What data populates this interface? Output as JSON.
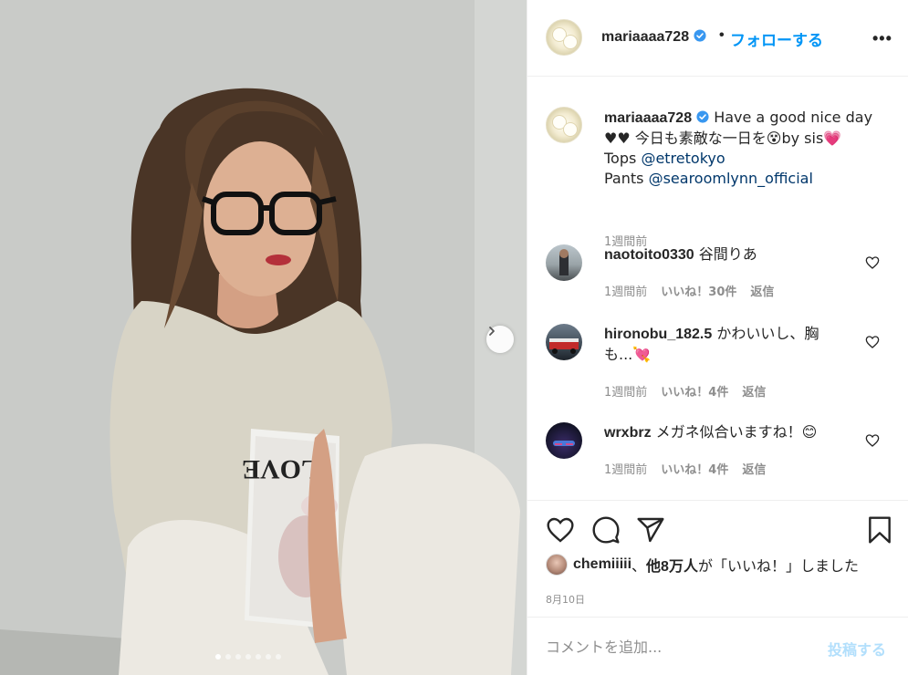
{
  "post": {
    "image_alt": "",
    "carousel_total": 7,
    "carousel_active": 1
  },
  "header": {
    "username": "mariaaaa728",
    "separator": "•",
    "follow_label": "フォローする",
    "more_label": "•••"
  },
  "caption": {
    "username": "mariaaaa728",
    "line1": "Have a good nice day",
    "line2": "♥♥ 今日も素敵な一日を😵by sis💗",
    "tops_label": "Tops",
    "tops_mention": "@etretokyo",
    "pants_label": "Pants",
    "pants_mention": "@searoomlynn_official",
    "time": "1週間前"
  },
  "comments": [
    {
      "username": "naotoito0330",
      "text": "谷間りあ",
      "time": "1週間前",
      "likes": "いいね！30件",
      "reply": "返信"
    },
    {
      "username": "hironobu_182.5",
      "text": "かわいいし、胸も...💘",
      "time": "1週間前",
      "likes": "いいね！4件",
      "reply": "返信"
    },
    {
      "username": "wrxbrz",
      "text": "メガネ似合いますね！😊",
      "time": "1週間前",
      "likes": "いいね！4件",
      "reply": "返信"
    }
  ],
  "liked_by": {
    "user": "chemiiiii",
    "middle": "、",
    "others": "他8万人",
    "suffix": "が「いいね！」しました"
  },
  "date": "8月10日",
  "comment_box": {
    "placeholder": "コメントを追加...",
    "post_label": "投稿する"
  },
  "colors": {
    "accent": "#0095f6",
    "mention": "#00376b",
    "muted": "#8e8e8e",
    "post_disabled": "#b2dffc"
  }
}
